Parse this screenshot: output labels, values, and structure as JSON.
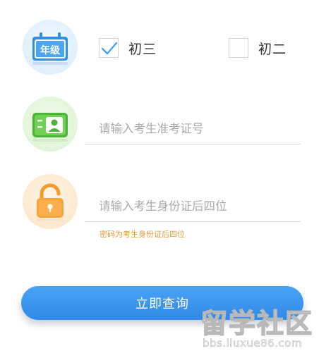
{
  "grade": {
    "icon_text": "年级",
    "options": [
      {
        "label": "初三",
        "checked": true
      },
      {
        "label": "初二",
        "checked": false
      }
    ]
  },
  "exam_number": {
    "icon": "student-id-card-icon",
    "placeholder": "请输入考生准考证号"
  },
  "password": {
    "icon": "padlock-icon",
    "placeholder": "请输入考生身份证后四位",
    "hint": "密码为考生身份证后四位"
  },
  "submit": {
    "label": "立即查询"
  },
  "watermark": {
    "title": "留学社区",
    "url": "bbs.liuxue86.com"
  },
  "colors": {
    "primary_blue": "#3390ea",
    "check_blue": "#49a2ee",
    "hint_orange": "#e09a3a",
    "card_green": "#5cbf3c",
    "lock_orange": "#f4a23c"
  }
}
